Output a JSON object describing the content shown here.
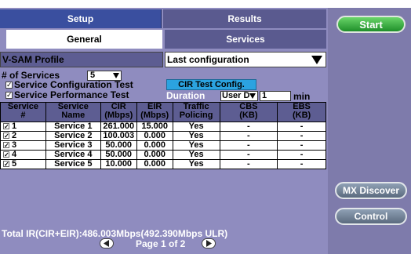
{
  "tabs": {
    "setup": "Setup",
    "results": "Results"
  },
  "subtabs": {
    "general": "General",
    "services": "Services"
  },
  "profile": {
    "label": "V-SAM Profile",
    "value": "Last configuration"
  },
  "num_services": {
    "label": "# of Services",
    "value": "5"
  },
  "tests": {
    "service_config": "Service Configuration Test",
    "service_perf": "Service Performance Test",
    "cir_button": "CIR Test Config.",
    "duration_label": "Duration",
    "duration_mode": "User D",
    "duration_value": "1",
    "duration_unit": "min"
  },
  "table": {
    "headers": [
      {
        "line1": "Service",
        "line2": "#"
      },
      {
        "line1": "Service",
        "line2": "Name"
      },
      {
        "line1": "CIR",
        "line2": "(Mbps)"
      },
      {
        "line1": "EIR",
        "line2": "(Mbps)"
      },
      {
        "line1": "Traffic",
        "line2": "Policing"
      },
      {
        "line1": "CBS",
        "line2": "(KB)"
      },
      {
        "line1": "EBS",
        "line2": "(KB)"
      }
    ],
    "rows": [
      {
        "num": "1",
        "name": "Service 1",
        "cir": "261.000",
        "eir": "15.000",
        "policing": "Yes",
        "cbs": "-",
        "ebs": "-"
      },
      {
        "num": "2",
        "name": "Service 2",
        "cir": "100.003",
        "eir": "0.000",
        "policing": "Yes",
        "cbs": "-",
        "ebs": "-"
      },
      {
        "num": "3",
        "name": "Service 3",
        "cir": "50.000",
        "eir": "0.000",
        "policing": "Yes",
        "cbs": "-",
        "ebs": "-"
      },
      {
        "num": "4",
        "name": "Service 4",
        "cir": "50.000",
        "eir": "0.000",
        "policing": "Yes",
        "cbs": "-",
        "ebs": "-"
      },
      {
        "num": "5",
        "name": "Service 5",
        "cir": "10.000",
        "eir": "0.000",
        "policing": "Yes",
        "cbs": "-",
        "ebs": "-"
      }
    ]
  },
  "total": "Total IR(CIR+EIR):486.003Mbps(492.390Mbps ULR)",
  "page": "Page 1 of 2",
  "side": {
    "start": "Start",
    "mx_discover": "MX Discover",
    "control": "Control"
  },
  "colors": {
    "panel": "#8f8cbf",
    "tab_active": "#3a4f9f",
    "start": "#2e9b38",
    "cir_button": "#2ba3e0"
  }
}
